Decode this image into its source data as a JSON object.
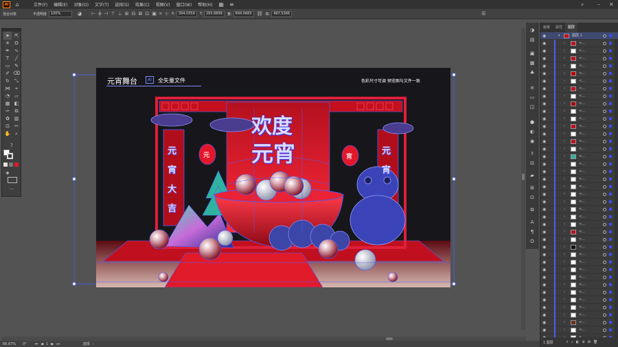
{
  "app": {
    "logo": "Ai"
  },
  "menu": [
    "文件(F)",
    "编辑(E)",
    "对象(O)",
    "文字(T)",
    "选择(S)",
    "效果(C)",
    "视图(V)",
    "窗口(W)",
    "帮助(H)"
  ],
  "control_bar": {
    "selection_label": "混合对象",
    "opacity_label": "不透明度",
    "opacity_value": "100%",
    "x_label": "X:",
    "x_value": "394.0559",
    "y_label": "Y:",
    "y_value": "265.6899",
    "w_label": "宽:",
    "w_value": "894.0683",
    "h_label": "高:",
    "h_value": "497.5366"
  },
  "artboard": {
    "title": "元宵舞台",
    "ai_badge": "Ai",
    "subtitle": "全矢量文件",
    "right_text": "色彩尺寸可调  预览图与文件一致",
    "headline_1": "欢度",
    "headline_2": "元宵",
    "lantern_left": "元",
    "lantern_right": "宵",
    "pillar_left": [
      "元",
      "宵",
      "大",
      "吉"
    ],
    "pillar_right": [
      "元",
      "宵"
    ]
  },
  "layers_panel": {
    "tabs": [
      "画板",
      "属性",
      "图层"
    ],
    "active_tab": "图层",
    "top_layer": "图层 1",
    "row_label": "<...",
    "footer_label": "1 图层"
  },
  "status_bar": {
    "zoom": "66.67%",
    "rotation": "0°",
    "artboard_nav": "1",
    "tool_name": "选择"
  },
  "colors": {
    "accent": "#4b5fff",
    "stage_red": "#d8162a",
    "background": "#17171b"
  }
}
